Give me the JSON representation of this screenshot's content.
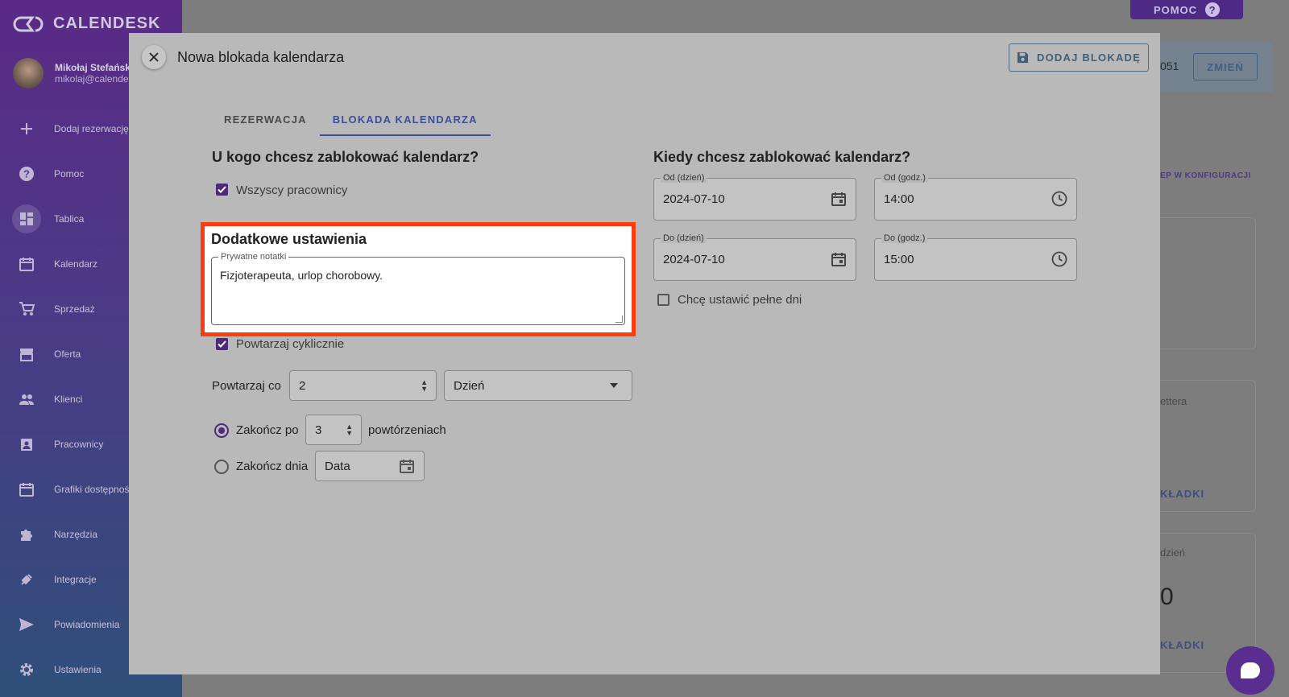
{
  "app": {
    "logo_text": "CALENDESK",
    "help_label": "POMOC",
    "help_icon": "?"
  },
  "user": {
    "name": "Mikołaj Stefański",
    "email": "mikolaj@calendesk.com"
  },
  "sidebar": {
    "items": [
      {
        "label": "Dodaj rezerwację",
        "icon": "plus-icon"
      },
      {
        "label": "Pomoc",
        "icon": "help-circle-icon"
      },
      {
        "label": "Tablica",
        "icon": "dashboard-icon"
      },
      {
        "label": "Kalendarz",
        "icon": "calendar-icon"
      },
      {
        "label": "Sprzedaż",
        "icon": "cart-icon"
      },
      {
        "label": "Oferta",
        "icon": "store-icon"
      },
      {
        "label": "Klienci",
        "icon": "people-icon"
      },
      {
        "label": "Pracownicy",
        "icon": "badge-icon"
      },
      {
        "label": "Grafiki dostępności",
        "icon": "schedule-icon"
      },
      {
        "label": "Narzędzia",
        "icon": "puzzle-icon"
      },
      {
        "label": "Integracje",
        "icon": "plug-icon"
      },
      {
        "label": "Powiadomienia",
        "icon": "send-icon"
      },
      {
        "label": "Ustawienia",
        "icon": "gear-icon"
      }
    ]
  },
  "background": {
    "code_fragment": "051",
    "change_label": "ZMIEŃ",
    "config_fragment": "EP W KONFIGURACJI",
    "card1_text": "ettera",
    "card1_link": "KŁADKI",
    "card2_text": "dzień",
    "card2_digit": "0",
    "card2_link": "KŁADKI"
  },
  "modal": {
    "title": "Nowa blokada kalendarza",
    "save_label": "DODAJ BLOKADĘ",
    "tabs": [
      {
        "label": "REZERWACJA",
        "active": false
      },
      {
        "label": "BLOKADA KALENDARZA",
        "active": true
      }
    ],
    "who": {
      "heading": "U kogo chcesz zablokować kalendarz?",
      "all_employees_label": "Wszyscy pracownicy",
      "all_employees_checked": true
    },
    "additional": {
      "heading": "Dodatkowe ustawienia",
      "notes_label": "Prywatne notatki",
      "notes_value": "Fizjoterapeuta, urlop chorobowy."
    },
    "repeat": {
      "checkbox_label": "Powtarzaj cyklicznie",
      "checked": true,
      "every_label": "Powtarzaj co",
      "every_value": "2",
      "unit_value": "Dzień",
      "end_after_label": "Zakończ po",
      "end_after_value": "3",
      "end_after_suffix": "powtórzeniach",
      "end_after_selected": true,
      "end_date_label": "Zakończ dnia",
      "end_date_placeholder": "Data"
    },
    "when": {
      "heading": "Kiedy chcesz zablokować kalendarz?",
      "from_date_label": "Od (dzień)",
      "from_date_value": "2024-07-10",
      "from_time_label": "Od (godz.)",
      "from_time_value": "14:00",
      "to_date_label": "Do (dzień)",
      "to_date_value": "2024-07-10",
      "to_time_label": "Do (godz.)",
      "to_time_value": "15:00",
      "full_days_label": "Chcę ustawić pełne dni",
      "full_days_checked": false
    }
  },
  "colors": {
    "accent": "#4b2a7a",
    "tab_active": "#3b4f9a",
    "highlight": "#ff3b10"
  }
}
